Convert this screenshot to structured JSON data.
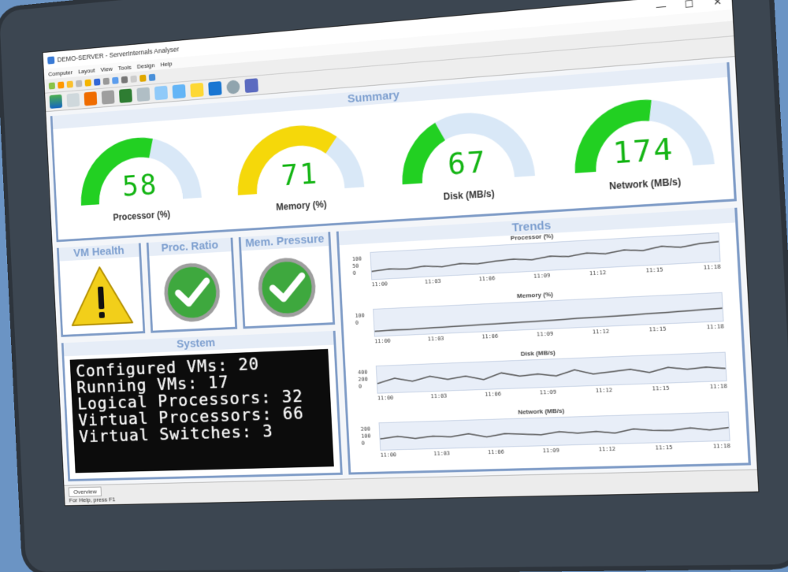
{
  "window": {
    "title": "DEMO-SERVER - ServerInternals Analyser"
  },
  "menu": [
    "Computer",
    "Layout",
    "View",
    "Tools",
    "Design",
    "Help"
  ],
  "panels": {
    "summary_title": "Summary",
    "trends_title": "Trends",
    "vm_health_title": "VM Health",
    "proc_ratio_title": "Proc. Ratio",
    "mem_pressure_title": "Mem. Pressure",
    "system_title": "System"
  },
  "gauges": [
    {
      "value": "58",
      "label": "Processor (%)",
      "fraction": 0.58,
      "color": "#22d022"
    },
    {
      "value": "71",
      "label": "Memory (%)",
      "fraction": 0.71,
      "color": "#f5d80a"
    },
    {
      "value": "67",
      "label": "Disk (MB/s)",
      "fraction": 0.35,
      "color": "#22d022"
    },
    {
      "value": "174",
      "label": "Network (MB/s)",
      "fraction": 0.55,
      "color": "#22d022"
    }
  ],
  "system": {
    "lines": [
      "Configured VMs: 20",
      "Running VMs: 17",
      "Logical Processors: 32",
      "Virtual Processors: 66",
      "Virtual Switches: 3"
    ]
  },
  "trends": [
    {
      "title": "Processor (%)",
      "yticks": [
        "100",
        "50",
        "0"
      ]
    },
    {
      "title": "Memory (%)",
      "yticks": [
        "100",
        "0"
      ]
    },
    {
      "title": "Disk (MB/s)",
      "yticks": [
        "400",
        "200",
        "0"
      ]
    },
    {
      "title": "Network (MB/s)",
      "yticks": [
        "200",
        "100",
        "0"
      ]
    }
  ],
  "trend_times": [
    "11:00",
    "11:03",
    "11:06",
    "11:09",
    "11:12",
    "11:15",
    "11:18"
  ],
  "status": {
    "tab": "Overview",
    "help": "For Help, press F1"
  },
  "colors": {
    "panel_border": "#7f9cc7",
    "gauge_green": "#22d022",
    "gauge_yellow": "#f5d80a",
    "gauge_track": "#d9e8f7",
    "status_ok": "#3ea83e",
    "warning": "#f2cf1a"
  }
}
